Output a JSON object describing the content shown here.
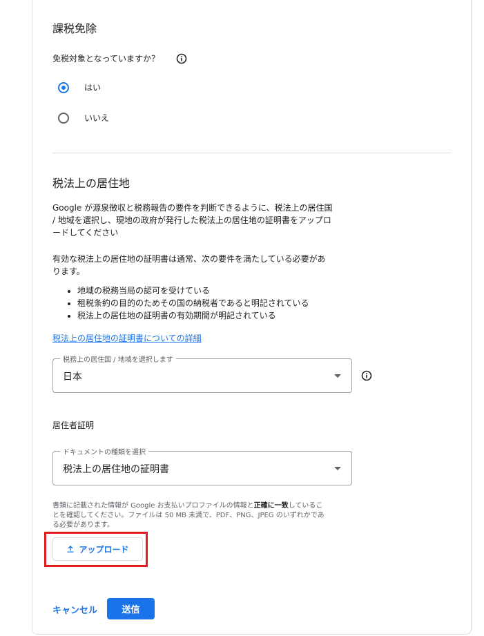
{
  "tax_exempt": {
    "heading": "課税免除",
    "question": "免税対象となっていますか？",
    "options": [
      {
        "label": "はい",
        "selected": true
      },
      {
        "label": "いいえ",
        "selected": false
      }
    ]
  },
  "residency": {
    "heading": "税法上の居住地",
    "intro_lines": [
      "Google が源泉徴収と税務報告の要件を判断できるように、税法上の居住国",
      "/ 地域を選択し、現地の政府が発行した税法上の居住地の証明書をアップロ",
      "ードしてください"
    ],
    "requirements_intro_lines": [
      "有効な税法上の居住地の証明書は通常、次の要件を満たしている必要があ",
      "ります。"
    ],
    "requirements": [
      "地域の税務当局の認可を受けている",
      "租税条約の目的のためその国の納税者であると明記されている",
      "税法上の居住地の証明書の有効期間が明記されている"
    ],
    "details_link": "税法上の居住地の証明書についての詳細",
    "country_select": {
      "label": "税務上の居住国 / 地域を選択します",
      "value": "日本"
    }
  },
  "certificate": {
    "heading": "居住者証明",
    "doc_select": {
      "label": "ドキュメントの種類を選択",
      "value": "税法上の居住地の証明書"
    },
    "note_line1_a": "書類に記載された情報が Google お支払いプロファイルの情報と",
    "note_line1_bold": "正確に一致",
    "note_line1_b": "しているこ",
    "note_line2": "とを確認してください。ファイルは 50 MB 未満で、PDF、PNG、JPEG のいずれかであ",
    "note_line3": "る必要があります。",
    "upload_label": "アップロード"
  },
  "actions": {
    "cancel": "キャンセル",
    "submit": "送信"
  },
  "colors": {
    "accent": "#1a73e8",
    "highlight": "#e01d1d"
  }
}
